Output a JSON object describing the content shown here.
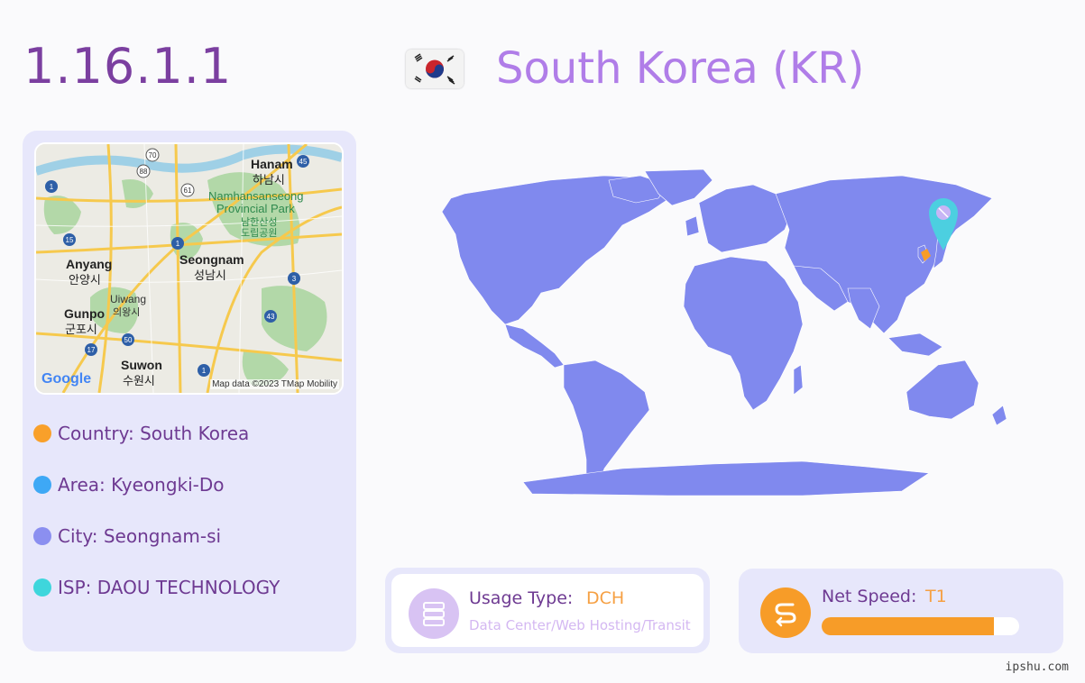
{
  "header": {
    "ip": "1.16.1.1",
    "country_title": "South Korea (KR)",
    "flag_icon": "south-korea-flag-icon"
  },
  "minimap": {
    "labels": {
      "hanam": "Hanam",
      "hanam_ko": "하남시",
      "namhansan": "Namhansanseong",
      "namhansan2": "Provincial Park",
      "namhansan_ko": "남한산성",
      "namhansan_ko2": "도립공원",
      "anyang": "Anyang",
      "anyang_ko": "안양시",
      "seongnam": "Seongnam",
      "seongnam_ko": "성남시",
      "uiwang": "Uiwang",
      "uiwang_ko": "의왕시",
      "gunpo": "Gunpo",
      "gunpo_ko": "군포시",
      "suwon": "Suwon",
      "suwon_ko": "수원시",
      "google": "Google",
      "attribution": "Map data ©2023 TMap Mobility"
    },
    "route_shields": [
      "70",
      "88",
      "45",
      "1",
      "61",
      "15",
      "1",
      "3",
      "43",
      "50",
      "17",
      "1"
    ]
  },
  "info": {
    "country": "Country: South Korea",
    "area": "Area: Kyeongki-Do",
    "city": "City: Seongnam-si",
    "isp": "ISP: DAOU TECHNOLOGY",
    "colors": {
      "country": "#f9a02a",
      "area": "#3ea8f5",
      "city": "#8b8ff0",
      "isp": "#3ed6dc"
    }
  },
  "usage": {
    "label": "Usage Type:",
    "value": "DCH",
    "description": "Data Center/Web Hosting/Transit",
    "icon": "server-icon"
  },
  "speed": {
    "label": "Net Speed:",
    "value": "T1",
    "level": 0.87,
    "icon": "speed-icon"
  },
  "footer": {
    "site": "ipshu.com"
  },
  "theme": {
    "accent": "#7b3fa0",
    "title": "#b07de8",
    "map": "#8089ee",
    "panel": "#e7e7fb",
    "orange": "#f79c28",
    "pin": "#4ccfe0"
  }
}
